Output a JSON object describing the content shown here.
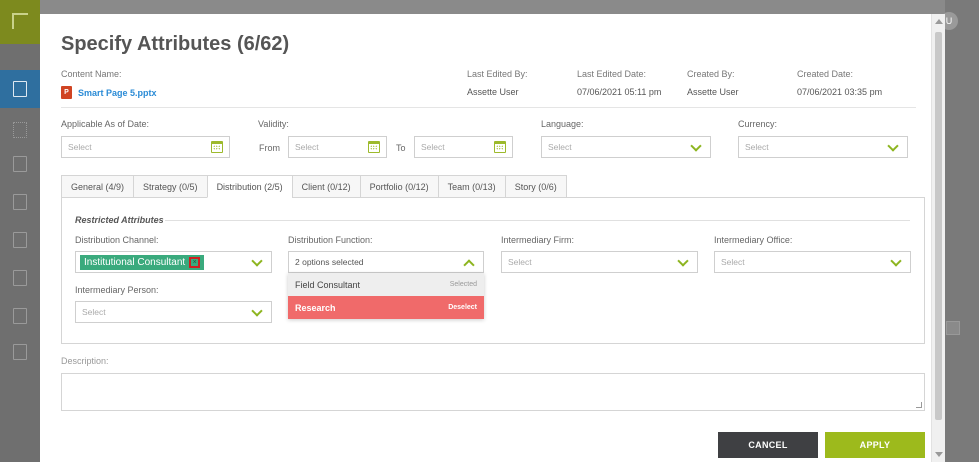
{
  "background": {
    "avatar_letter": "U"
  },
  "modal": {
    "title": "Specify Attributes (6/62)",
    "meta": {
      "content_name_label": "Content Name:",
      "content_name": "Smart Page 5.pptx",
      "last_edited_by_label": "Last Edited By:",
      "last_edited_by": "Assette User",
      "last_edited_date_label": "Last Edited Date:",
      "last_edited_date": "07/06/2021 05:11 pm",
      "created_by_label": "Created By:",
      "created_by": "Assette User",
      "created_date_label": "Created Date:",
      "created_date": "07/06/2021 03:35 pm"
    },
    "filters": {
      "applicable_label": "Applicable As of Date:",
      "applicable_placeholder": "Select",
      "validity_label": "Validity:",
      "from_label": "From",
      "from_placeholder": "Select",
      "to_label": "To",
      "to_placeholder": "Select",
      "language_label": "Language:",
      "language_placeholder": "Select",
      "currency_label": "Currency:",
      "currency_placeholder": "Select"
    },
    "tabs": [
      {
        "label": "General (4/9)"
      },
      {
        "label": "Strategy (0/5)"
      },
      {
        "label": "Distribution (2/5)"
      },
      {
        "label": "Client (0/12)"
      },
      {
        "label": "Portfolio (0/12)"
      },
      {
        "label": "Team (0/13)"
      },
      {
        "label": "Story (0/6)"
      }
    ],
    "active_tab": "Distribution (2/5)",
    "section": {
      "title": "Restricted Attributes",
      "distribution_channel_label": "Distribution Channel:",
      "distribution_channel_chip": "Institutional Consultant",
      "chip_remove": "×",
      "distribution_function_label": "Distribution Function:",
      "distribution_function_value": "2 options selected",
      "intermediary_firm_label": "Intermediary Firm:",
      "intermediary_firm_placeholder": "Select",
      "intermediary_office_label": "Intermediary Office:",
      "intermediary_office_placeholder": "Select",
      "intermediary_person_label": "Intermediary Person:",
      "intermediary_person_placeholder": "Select"
    },
    "dropdown_options": [
      {
        "label": "Field Consultant",
        "tag": "Selected"
      },
      {
        "label": "Research",
        "tag": "Deselect"
      }
    ],
    "description_label": "Description:",
    "cancel_label": "CANCEL",
    "apply_label": "APPLY",
    "colors": {
      "accent_green": "#9dba1c",
      "chip_green": "#3aaa7d",
      "highlight_red": "#f06a6a",
      "link_blue": "#2a8bd6"
    }
  }
}
